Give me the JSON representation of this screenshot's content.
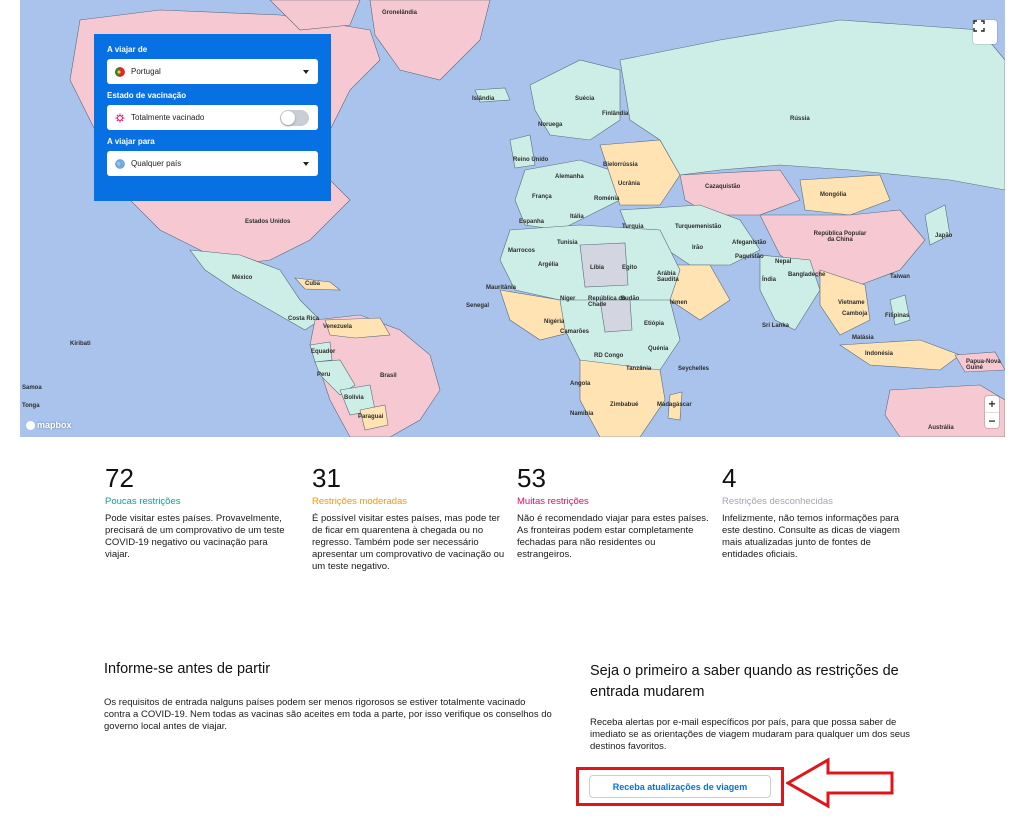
{
  "map": {
    "labels": {
      "greenland": "Gronelândia",
      "iceland": "Islândia",
      "sweden": "Suécia",
      "finland": "Finlândia",
      "norway": "Noruega",
      "russia": "Rússia",
      "uk": "Reino Unido",
      "belarus": "Bielorrússia",
      "germany": "Alemanha",
      "ukraine": "Ucrânia",
      "france": "França",
      "romania": "Roménia",
      "kazakhstan": "Cazaquistão",
      "mongolia": "Mongólia",
      "spain": "Espanha",
      "italy": "Itália",
      "turkey": "Turquia",
      "turkmenistan": "Turquemenistão",
      "usa": "Estados Unidos",
      "china": "República Popular da China",
      "japan": "Japão",
      "morocco": "Marrocos",
      "tunisia": "Tunísia",
      "iran": "Irão",
      "afghanistan": "Afeganistão",
      "pakistan": "Paquistão",
      "nepal": "Nepal",
      "algeria": "Argélia",
      "libya": "Líbia",
      "egypt": "Egito",
      "mexico": "México",
      "cuba": "Cuba",
      "mauritania": "Mauritânia",
      "saudi": "Arábia Saudita",
      "india": "Índia",
      "bangladesh": "Bangladeche",
      "taiwan": "Taiwan",
      "vietnam": "Vietname",
      "philippines": "Filipinas",
      "niger": "Níger",
      "chad": "República do Chade",
      "sudan": "Sudão",
      "yemen": "Iémen",
      "senegal": "Senegal",
      "cambodia": "Camboja",
      "costa_rica": "Costa Rica",
      "venezuela": "Venezuela",
      "nigeria": "Nigéria",
      "ethiopia": "Etiópia",
      "sri_lanka": "Sri Lanka",
      "cameroon": "Camarões",
      "malaysia": "Malásia",
      "kiribati": "Kiribati",
      "ecuador": "Equador",
      "rd_congo": "RD Congo",
      "kenya": "Quénia",
      "indonesia": "Indonésia",
      "png": "Papua-Nova Guiné",
      "peru": "Peru",
      "brazil": "Brasil",
      "tanzania": "Tanzânia",
      "seychelles": "Seychelles",
      "samoa": "Samoa",
      "angola": "Angola",
      "bolivia": "Bolívia",
      "zimbabwe": "Zimbabué",
      "madagascar": "Madagáscar",
      "tonga": "Tonga",
      "paraguay": "Paraguai",
      "namibia": "Namíbia",
      "australia": "Austrália"
    },
    "attribution": "mapbox",
    "zoom_in": "+",
    "zoom_out": "−",
    "colors": {
      "ocean": "#a9c3ec",
      "few": "#cdeee6",
      "moderate": "#ffe3b3",
      "many": "#f6c9d2",
      "unknown": "#d3d6e0"
    }
  },
  "filters": {
    "from": {
      "label": "A viajar de",
      "value": "Portugal",
      "icon": "portugal-flag-icon"
    },
    "vaccination": {
      "label": "Estado de vacinação",
      "value": "Totalmente vacinado",
      "icon": "virus-icon",
      "enabled": false
    },
    "to": {
      "label": "A viajar para",
      "value": "Qualquer país",
      "icon": "globe-icon"
    }
  },
  "stats": [
    {
      "count": "72",
      "category": "Poucas restrições",
      "color": "#00a698",
      "description": "Pode visitar estes países. Provavelmente, precisará de um comprovativo de um teste COVID-19 negativo ou vacinação para viajar."
    },
    {
      "count": "31",
      "category": "Restrições moderadas",
      "color": "#ff9400",
      "description": "É possível visitar estes países, mas pode ter de ficar em quarentena à chegada ou no regresso. Também pode ser necessário apresentar um comprovativo de vacinação ou um teste negativo."
    },
    {
      "count": "53",
      "category": "Muitas restrições",
      "color": "#e70866",
      "description": "Não é recomendado viajar para estes países. As fronteiras podem estar completamente fechadas para não residentes ou estrangeiros."
    },
    {
      "count": "4",
      "category": "Restrições desconhecidas",
      "color": "#a0a6b6",
      "description": "Infelizmente, não temos informações para este destino. Consulte as dicas de viagem mais atualizadas junto de fontes de entidades oficiais."
    }
  ],
  "info": {
    "title": "Informe-se antes de partir",
    "text": "Os requisitos de entrada nalguns países podem ser menos rigorosos se estiver totalmente vacinado contra a COVID-19. Nem todas as vacinas são aceites em toda a parte, por isso verifique os conselhos do governo local antes de viajar."
  },
  "alerts": {
    "title": "Seja o primeiro a saber quando as restrições de entrada mudarem",
    "text": "Receba alertas por e-mail específicos por país, para que possa saber de imediato se as orientações de viagem mudaram para qualquer um dos seus destinos favoritos.",
    "button_label": "Receba atualizações de viagem",
    "highlight_color": "#e0151b"
  }
}
